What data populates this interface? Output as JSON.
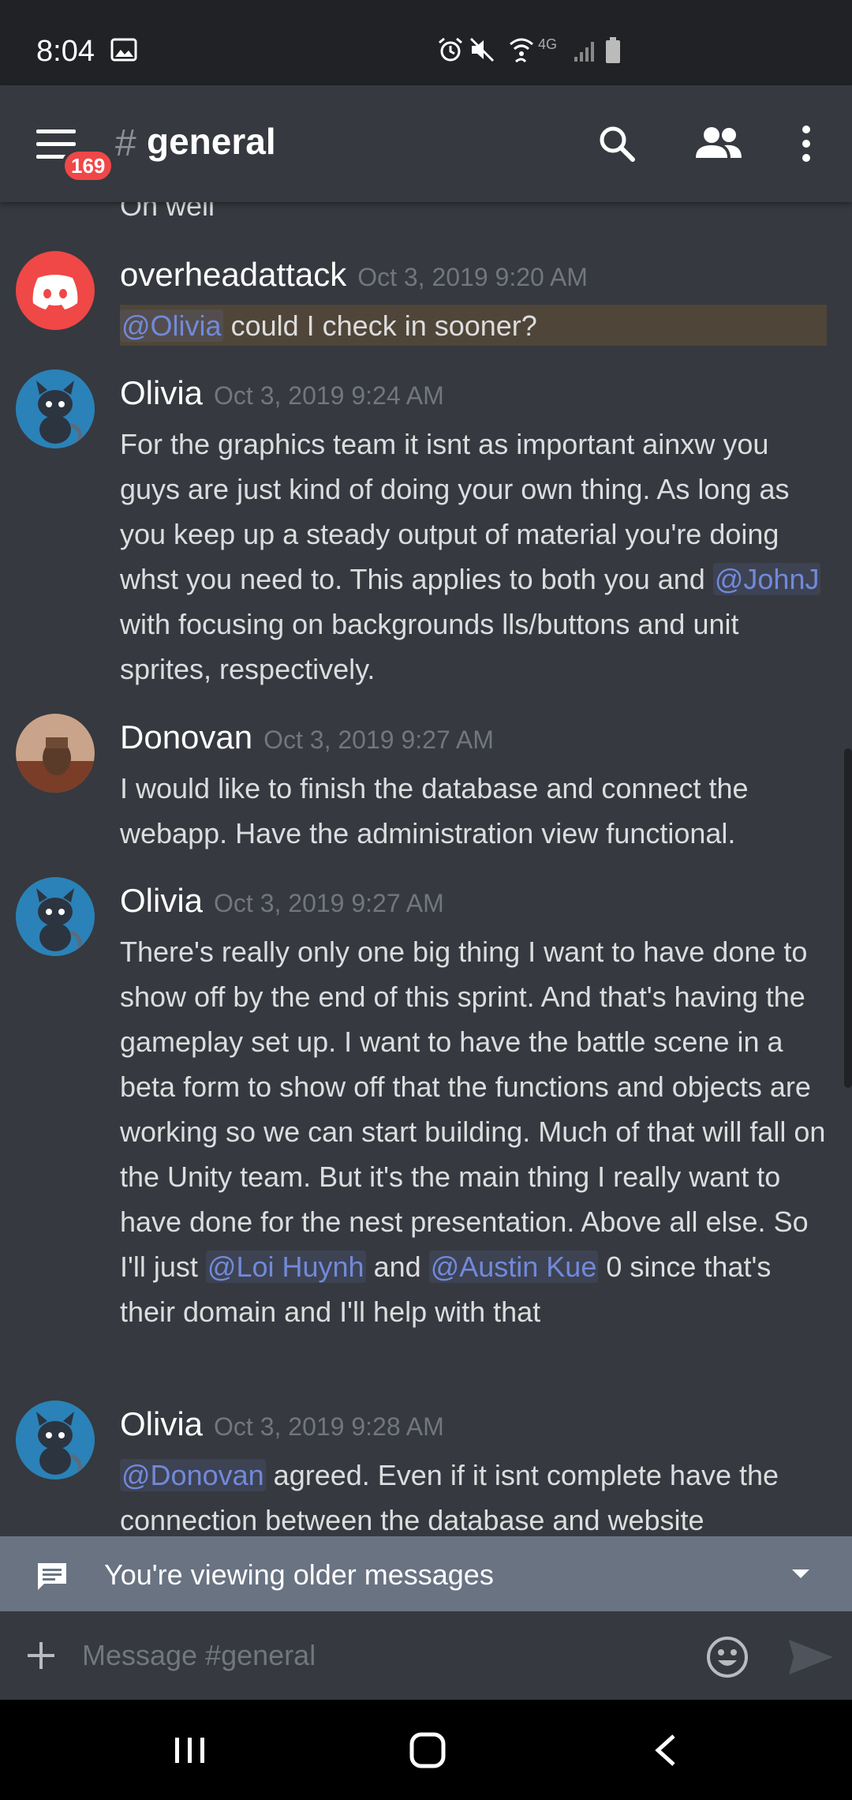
{
  "status_bar": {
    "time": "8:04",
    "network": "4G"
  },
  "app_bar": {
    "unread_badge": "169",
    "hash": "#",
    "channel": "general"
  },
  "chat": {
    "cut_off_text": "Oh well",
    "messages": [
      {
        "author": "overheadattack",
        "timestamp": "Oct 3, 2019 9:20 AM",
        "avatar": "discord-logo",
        "mention": "@Olivia",
        "text": "could I check in sooner?"
      },
      {
        "author": "Olivia",
        "timestamp": "Oct 3, 2019 9:24 AM",
        "avatar": "olivia-avatar",
        "text_before": "For the graphics team it isnt as important ainxw you guys are just kind of doing your own thing. As long as you keep up a steady output of material you're doing whst you need to. This applies to both you and",
        "mention": "@JohnJ",
        "text_after": "with focusing on backgrounds lls/buttons and unit sprites, respectively."
      },
      {
        "author": "Donovan",
        "timestamp": "Oct 3, 2019 9:27 AM",
        "avatar": "donovan-avatar",
        "text": "I would like to finish the database and connect the webapp. Have the administration view functional."
      },
      {
        "author": "Olivia",
        "timestamp": "Oct 3, 2019 9:27 AM",
        "avatar": "olivia-avatar",
        "text_before": "There's really only one big thing I want to have done to show off by the end of this sprint. And that's having the gameplay set up. I want to have the battle scene in a beta form to show off that the functions and objects are working so we can start building. Much of that will fall on the Unity team. But it's the main thing I really want to have done for the nest presentation. Above all else. So I'll just",
        "mention_1": "@Loi Huynh",
        "text_middle": "and",
        "mention_2": "@Austin Kue",
        "text_after": "0 since that's their domain and I'll help with that"
      },
      {
        "author": "Olivia",
        "timestamp": "Oct 3, 2019 9:28 AM",
        "avatar": "olivia-avatar",
        "mention": "@Donovan",
        "text": "agreed. Even if it isnt complete have the connection between the database and website"
      }
    ]
  },
  "older_messages_bar": {
    "label": "You're viewing older messages"
  },
  "composer": {
    "placeholder": "Message #general"
  },
  "colors": {
    "background": "#36393f",
    "status_bar": "#202225",
    "mention": "#7289da",
    "badge": "#f04747",
    "older_bar": "#697382",
    "timestamp": "#72767d"
  }
}
